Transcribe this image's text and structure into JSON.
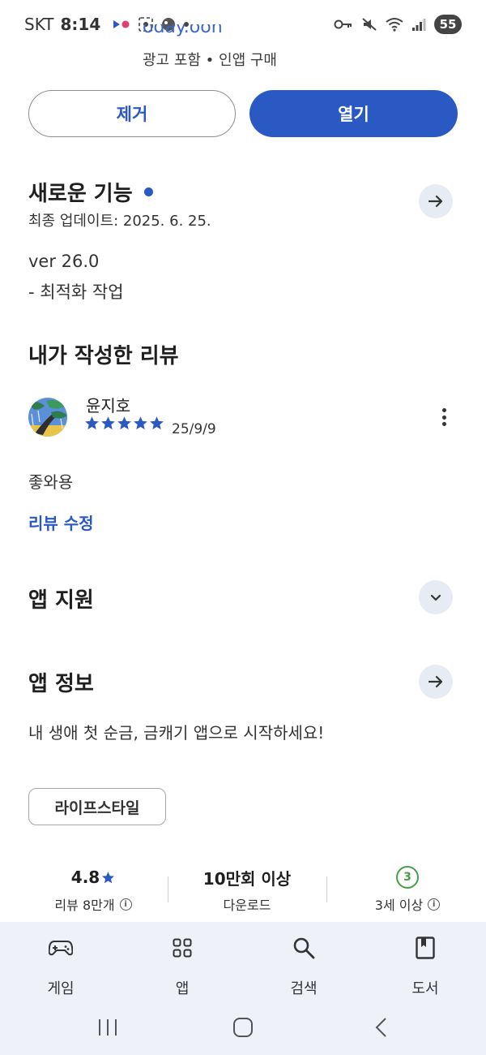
{
  "status_bar": {
    "carrier": "SKT",
    "time": "8:14",
    "battery": "55"
  },
  "header": {
    "cut_title": "oday.oon",
    "meta": "광고 포함 • 인앱 구매"
  },
  "actions": {
    "remove_label": "제거",
    "open_label": "열기"
  },
  "whats_new": {
    "title": "새로운 기능",
    "updated": "최종 업데이트: 2025. 6. 25.",
    "version": "ver 26.0",
    "note": "- 최적화 작업"
  },
  "my_review": {
    "title": "내가 작성한 리뷰",
    "reviewer": "윤지호",
    "rating": 5,
    "date": "25/9/9",
    "text": "좋와용",
    "edit_label": "리뷰 수정"
  },
  "app_support": {
    "title": "앱 지원"
  },
  "app_info": {
    "title": "앱 정보",
    "description": "내 생애 첫 순금, 금캐기 앱으로 시작하세요!",
    "category_chip": "라이프스타일"
  },
  "stats": {
    "rating_value": "4.8",
    "rating_label": "리뷰 8만개",
    "downloads_value": "10만회 이상",
    "downloads_label": "다운로드",
    "age_badge": "3",
    "age_label": "3세 이상"
  },
  "bottom_nav": {
    "items": [
      {
        "label": "게임",
        "icon": "gamepad-icon"
      },
      {
        "label": "앱",
        "icon": "apps-grid-icon"
      },
      {
        "label": "검색",
        "icon": "search-icon"
      },
      {
        "label": "도서",
        "icon": "book-icon"
      }
    ]
  },
  "colors": {
    "accent": "#2b59c3",
    "nav_bg": "#eef1f8",
    "age_green": "#43a047"
  }
}
